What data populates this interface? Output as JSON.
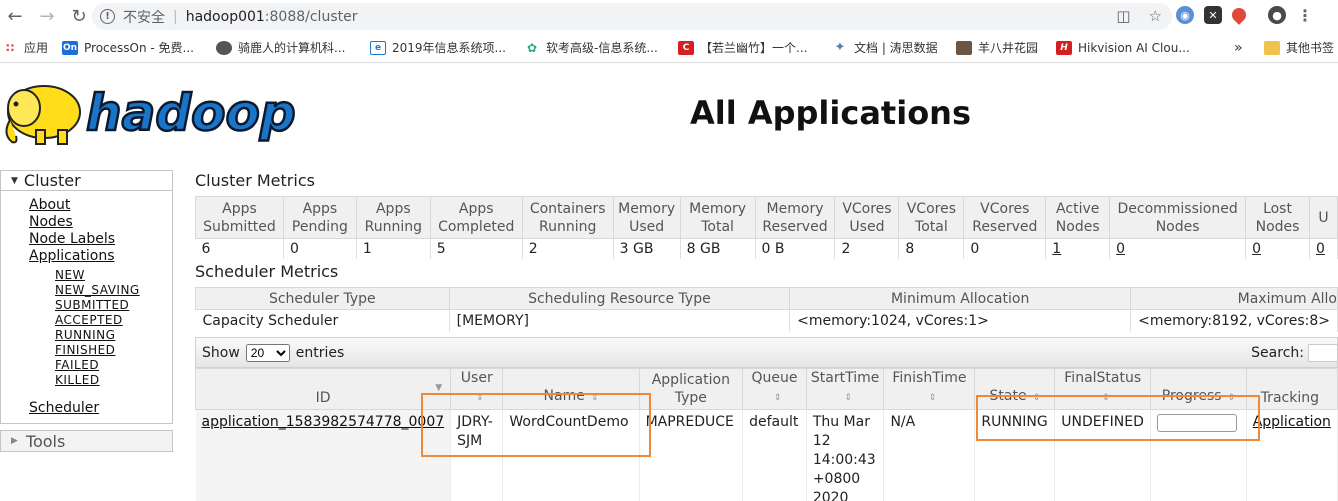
{
  "browser": {
    "security_label": "不安全",
    "url_host": "hadoop001",
    "url_rest": ":8088/cluster",
    "bookmarks": [
      "应用",
      "ProcessOn - 免费...",
      "骑鹿人的计算机科...",
      "2019年信息系统项...",
      "软考高级-信息系统...",
      "【若兰幽竹】一个...",
      "文档 | 涛思数据",
      "羊八井花园",
      "Hikvision AI Clou..."
    ],
    "bookmarks_more": "»",
    "other_bookmarks": "其他书签"
  },
  "logo_text": "hadoop",
  "page_title": "All Applications",
  "sidebar": {
    "cluster_label": "Cluster",
    "links": [
      "About",
      "Nodes",
      "Node Labels",
      "Applications"
    ],
    "app_states": [
      "NEW",
      "NEW_SAVING",
      "SUBMITTED",
      "ACCEPTED",
      "RUNNING",
      "FINISHED",
      "FAILED",
      "KILLED"
    ],
    "scheduler_link": "Scheduler",
    "tools_label": "Tools"
  },
  "cluster_metrics": {
    "title": "Cluster Metrics",
    "headers": [
      [
        "Apps",
        "Submitted"
      ],
      [
        "Apps",
        "Pending"
      ],
      [
        "Apps",
        "Running"
      ],
      [
        "Apps",
        "Completed"
      ],
      [
        "Containers",
        "Running"
      ],
      [
        "Memory",
        "Used"
      ],
      [
        "Memory",
        "Total"
      ],
      [
        "Memory",
        "Reserved"
      ],
      [
        "VCores",
        "Used"
      ],
      [
        "VCores",
        "Total"
      ],
      [
        "VCores",
        "Reserved"
      ],
      [
        "Active",
        "Nodes"
      ],
      [
        "Decommissioned",
        "Nodes"
      ],
      [
        "Lost",
        "Nodes"
      ],
      [
        "U",
        ""
      ]
    ],
    "values": [
      "6",
      "0",
      "1",
      "5",
      "2",
      "3 GB",
      "8 GB",
      "0 B",
      "2",
      "8",
      "0",
      "1",
      "0",
      "0",
      "0"
    ]
  },
  "scheduler_metrics": {
    "title": "Scheduler Metrics",
    "headers": [
      "Scheduler Type",
      "Scheduling Resource Type",
      "Minimum Allocation",
      "Maximum Allo"
    ],
    "values": [
      "Capacity Scheduler",
      "[MEMORY]",
      "<memory:1024, vCores:1>",
      "<memory:8192, vCores:8>"
    ]
  },
  "apps_table": {
    "show_label": "Show",
    "page_size": "20",
    "entries_label": "entries",
    "search_label": "Search:",
    "headers": [
      "ID",
      "User",
      "Name",
      "Application Type",
      "Queue",
      "StartTime",
      "FinishTime",
      "State",
      "FinalStatus",
      "Progress",
      "Tracking"
    ],
    "row": {
      "id": "application_1583982574778_0007",
      "user": "JDRY-SJM",
      "name": "WordCountDemo",
      "type": "MAPREDUCE",
      "queue": "default",
      "start_time": "Thu Mar 12 14:00:43 +0800 2020",
      "finish_time": "N/A",
      "state": "RUNNING",
      "final_status": "UNDEFINED",
      "progress": 0,
      "tracking": "Application"
    }
  },
  "colors": {
    "highlight": "#f0883a",
    "logo_yellow": "#ffdd1a",
    "logo_blue": "#1a74c7"
  }
}
